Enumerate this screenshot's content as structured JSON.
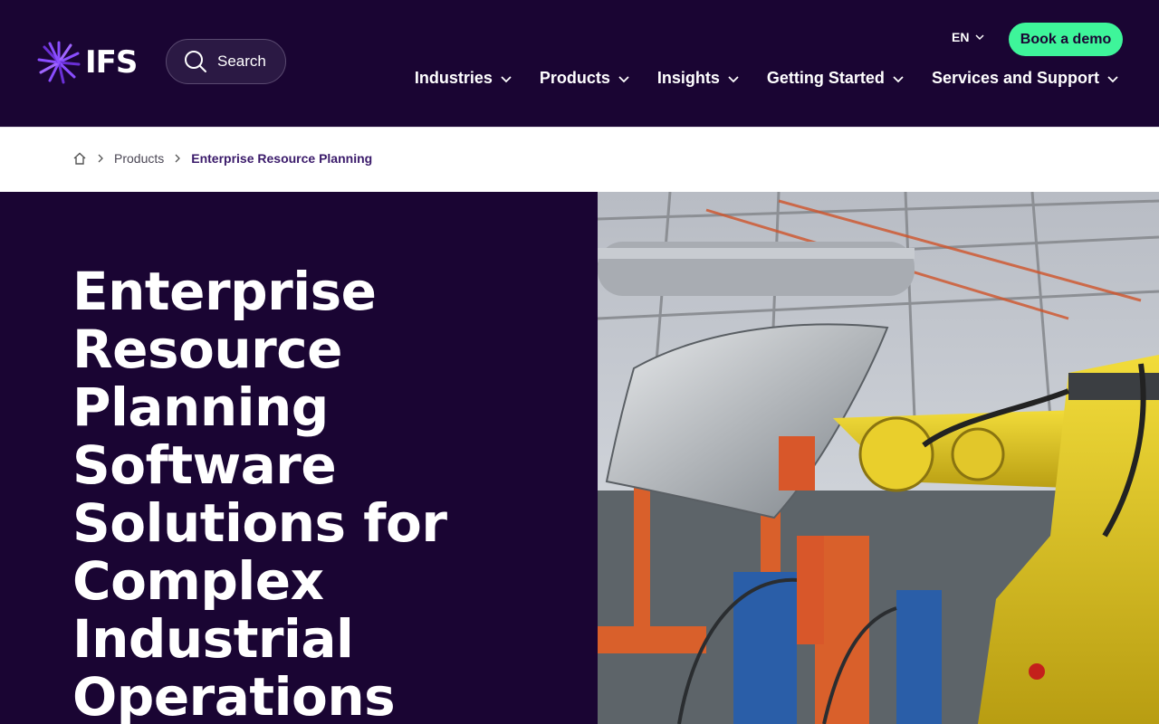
{
  "header": {
    "logo_text": "IFS",
    "search_label": "Search",
    "language": "EN",
    "demo_label": "Book a demo",
    "nav": [
      {
        "label": "Industries"
      },
      {
        "label": "Products"
      },
      {
        "label": "Insights"
      },
      {
        "label": "Getting Started"
      },
      {
        "label": "Services and Support"
      }
    ]
  },
  "breadcrumb": {
    "items": [
      "Products",
      "Enterprise Resource Planning"
    ]
  },
  "hero": {
    "title": "Enterprise Resource Planning Software Solutions for Complex Industrial Operations",
    "image_icon": "industrial-robot-photo"
  },
  "colors": {
    "brand_dark": "#1a0533",
    "accent_green": "#3ef59a",
    "logo_purple": "#7b3ff2"
  }
}
